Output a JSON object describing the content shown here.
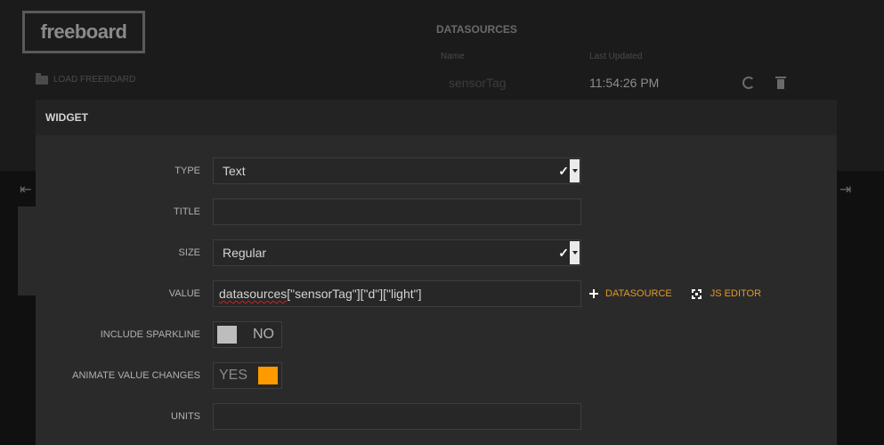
{
  "header": {
    "logo": "freeboard",
    "load_label": "LOAD FREEBOARD"
  },
  "datasources": {
    "title": "DATASOURCES",
    "col_name": "Name",
    "col_updated": "Last Updated",
    "rows": [
      {
        "name": "sensorTag",
        "updated": "11:54:26 PM"
      }
    ]
  },
  "dialog": {
    "title": "WIDGET",
    "type_label": "TYPE",
    "type_value": "Text",
    "title_label": "TITLE",
    "title_value": "",
    "size_label": "SIZE",
    "size_value": "Regular",
    "value_label": "VALUE",
    "value_prefix": "datasources",
    "value_rest": "[\"sensorTag\"][\"d\"][\"light\"]",
    "datasource_link": "DATASOURCE",
    "js_editor_link": "JS EDITOR",
    "sparkline_label": "INCLUDE SPARKLINE",
    "sparkline_state": "NO",
    "animate_label": "ANIMATE VALUE CHANGES",
    "animate_state": "YES",
    "units_label": "UNITS",
    "units_value": ""
  },
  "colors": {
    "accent": "#ff9900",
    "link": "#e09a2b",
    "background": "#101010",
    "modal": "#2a2a2a"
  }
}
